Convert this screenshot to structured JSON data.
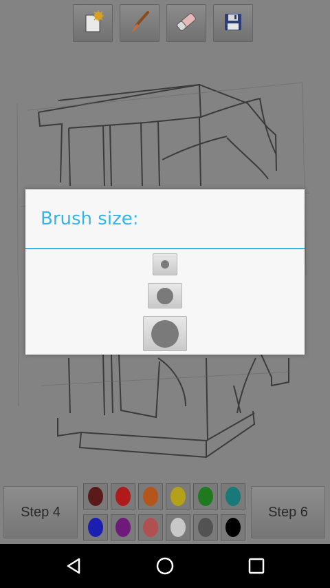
{
  "toolbar": {
    "tools": [
      {
        "name": "new-page-icon"
      },
      {
        "name": "brush-icon"
      },
      {
        "name": "eraser-icon"
      },
      {
        "name": "save-icon"
      }
    ]
  },
  "dialog": {
    "title": "Brush size:",
    "sizes": [
      "small",
      "medium",
      "large"
    ],
    "accent_color": "#34b5e5"
  },
  "steps": {
    "prev_label": "Step 4",
    "next_label": "Step 6"
  },
  "palette": {
    "colors": [
      "#5a1a1a",
      "#b11a1a",
      "#b4561c",
      "#b4a019",
      "#1f7a1f",
      "#197878",
      "#1b1fb0",
      "#6e1a7a",
      "#b05050",
      "#c8c8c8",
      "#525252",
      "#000000"
    ]
  },
  "navbar": {
    "buttons": [
      "back-icon",
      "home-icon",
      "recents-icon"
    ]
  }
}
